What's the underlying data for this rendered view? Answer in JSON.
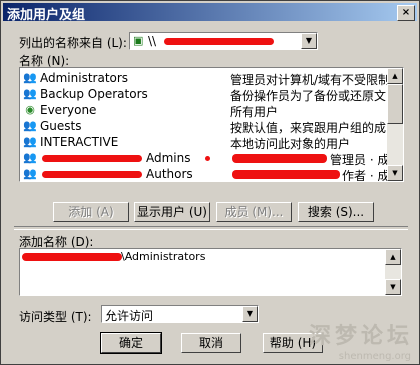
{
  "window": {
    "title": "添加用户及组",
    "close_glyph": "×"
  },
  "source": {
    "label": "列出的名称来自 (L):",
    "value_prefix": "\\\\"
  },
  "names": {
    "label": "名称 (N):",
    "rows": [
      {
        "name": "Administrators",
        "desc": "管理员对计算机/域有不受限制",
        "icon": "group-icon"
      },
      {
        "name": "Backup Operators",
        "desc": "备份操作员为了备份或还原文",
        "icon": "group-icon"
      },
      {
        "name": "Everyone",
        "desc": "所有用户",
        "icon": "globe-icon"
      },
      {
        "name": "Guests",
        "desc": "按默认值，来宾跟用户组的成",
        "icon": "group-icon"
      },
      {
        "name": "INTERACTIVE",
        "desc": "本地访问此对象的用户",
        "icon": "group-icon"
      },
      {
        "name": "Admins",
        "desc": "管理员 · 成",
        "icon": "group-icon"
      },
      {
        "name": "Authors",
        "desc": "作者 · 成员",
        "icon": "group-icon"
      }
    ]
  },
  "buttons": {
    "add": "添加 (A)",
    "show_users": "显示用户 (U)",
    "members": "成员 (M)...",
    "search": "搜索 (S)..."
  },
  "add_names": {
    "label": "添加名称 (D):",
    "value": "\\Administrators"
  },
  "access": {
    "label": "访问类型 (T):",
    "value": "允许访问"
  },
  "footer": {
    "ok": "确定",
    "cancel": "取消",
    "help": "帮助 (H)"
  },
  "watermark": {
    "text": "深梦论坛",
    "url": "shenmeng.org"
  }
}
